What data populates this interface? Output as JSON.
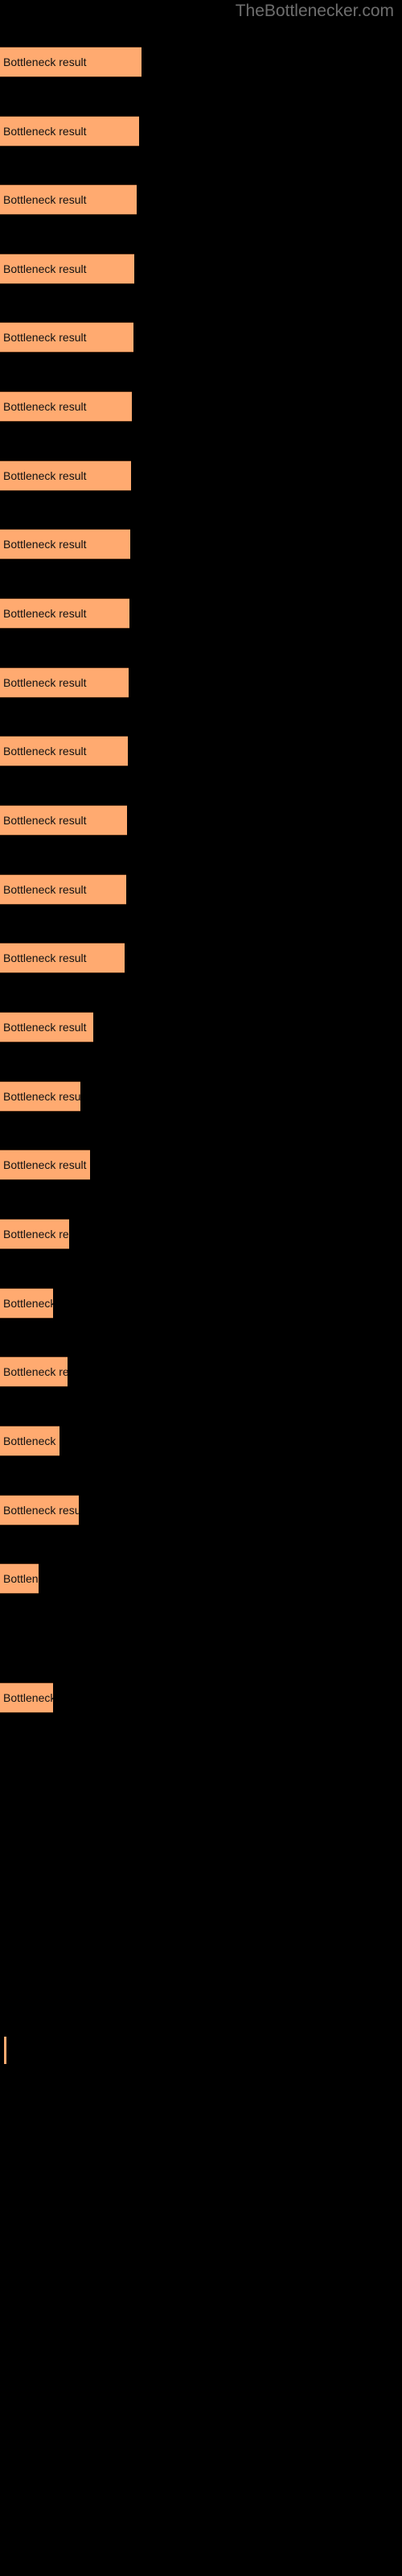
{
  "site": {
    "watermark": "TheBottlenecker.com"
  },
  "colors": {
    "background": "#000000",
    "bar_fill": "#ffaa70",
    "bar_border": "#4a2a14",
    "label_text": "#111111",
    "watermark_text": "#6e6e6e"
  },
  "chart_data": {
    "type": "bar",
    "orientation": "horizontal",
    "title": "",
    "subtitle": "",
    "xlabel": "",
    "ylabel": "",
    "grid": false,
    "legend": false,
    "axis_visible": false,
    "tick_labels": [],
    "categories": [
      "Bottleneck result",
      "Bottleneck result",
      "Bottleneck result",
      "Bottleneck result",
      "Bottleneck result",
      "Bottleneck result",
      "Bottleneck result",
      "Bottleneck result",
      "Bottleneck result",
      "Bottleneck result",
      "Bottleneck result",
      "Bottleneck result",
      "Bottleneck result",
      "Bottleneck result",
      "Bottleneck result",
      "Bottleneck result",
      "Bottleneck result",
      "Bottleneck result",
      "Bottleneck result",
      "Bottleneck result",
      "Bottleneck result",
      "Bottleneck result",
      "Bottleneck result",
      "Bottleneck result"
    ],
    "values": [
      176,
      173,
      170,
      167,
      166,
      164,
      163,
      162,
      161,
      160,
      159,
      158,
      157,
      155,
      116,
      100,
      112,
      86,
      66,
      84,
      74,
      98,
      48,
      66
    ],
    "xlim": [
      0,
      500
    ],
    "bars": [
      {
        "index": 1,
        "label": "Bottleneck result",
        "width": 176,
        "top": 58
      },
      {
        "index": 2,
        "label": "Bottleneck result",
        "width": 173,
        "top": 144
      },
      {
        "index": 3,
        "label": "Bottleneck result",
        "width": 170,
        "top": 229
      },
      {
        "index": 4,
        "label": "Bottleneck result",
        "width": 167,
        "top": 315
      },
      {
        "index": 5,
        "label": "Bottleneck result",
        "width": 166,
        "top": 400
      },
      {
        "index": 6,
        "label": "Bottleneck result",
        "width": 164,
        "top": 486
      },
      {
        "index": 7,
        "label": "Bottleneck result",
        "width": 163,
        "top": 572
      },
      {
        "index": 8,
        "label": "Bottleneck result",
        "width": 162,
        "top": 657
      },
      {
        "index": 9,
        "label": "Bottleneck result",
        "width": 161,
        "top": 743
      },
      {
        "index": 10,
        "label": "Bottleneck result",
        "width": 160,
        "top": 829
      },
      {
        "index": 11,
        "label": "Bottleneck result",
        "width": 159,
        "top": 914
      },
      {
        "index": 12,
        "label": "Bottleneck result",
        "width": 158,
        "top": 1000
      },
      {
        "index": 13,
        "label": "Bottleneck result",
        "width": 157,
        "top": 1086
      },
      {
        "index": 14,
        "label": "Bottleneck result",
        "width": 155,
        "top": 1171
      },
      {
        "index": 15,
        "label": "Bottleneck result",
        "width": 116,
        "top": 1257
      },
      {
        "index": 16,
        "label": "Bottleneck result",
        "width": 100,
        "top": 1343
      },
      {
        "index": 17,
        "label": "Bottleneck result",
        "width": 112,
        "top": 1428
      },
      {
        "index": 18,
        "label": "Bottleneck result",
        "width": 86,
        "top": 1514
      },
      {
        "index": 19,
        "label": "Bottleneck result",
        "width": 66,
        "top": 1600
      },
      {
        "index": 20,
        "label": "Bottleneck result",
        "width": 84,
        "top": 1685
      },
      {
        "index": 21,
        "label": "Bottleneck result",
        "width": 74,
        "top": 1771
      },
      {
        "index": 22,
        "label": "Bottleneck result",
        "width": 98,
        "top": 1857
      },
      {
        "index": 23,
        "label": "Bottleneck result",
        "width": 48,
        "top": 1942
      },
      {
        "index": 24,
        "label": "Bottleneck result",
        "width": 66,
        "top": 2090
      }
    ],
    "axis_tick": {
      "x": 5,
      "y": 2530,
      "width": 3,
      "height": 34
    }
  }
}
